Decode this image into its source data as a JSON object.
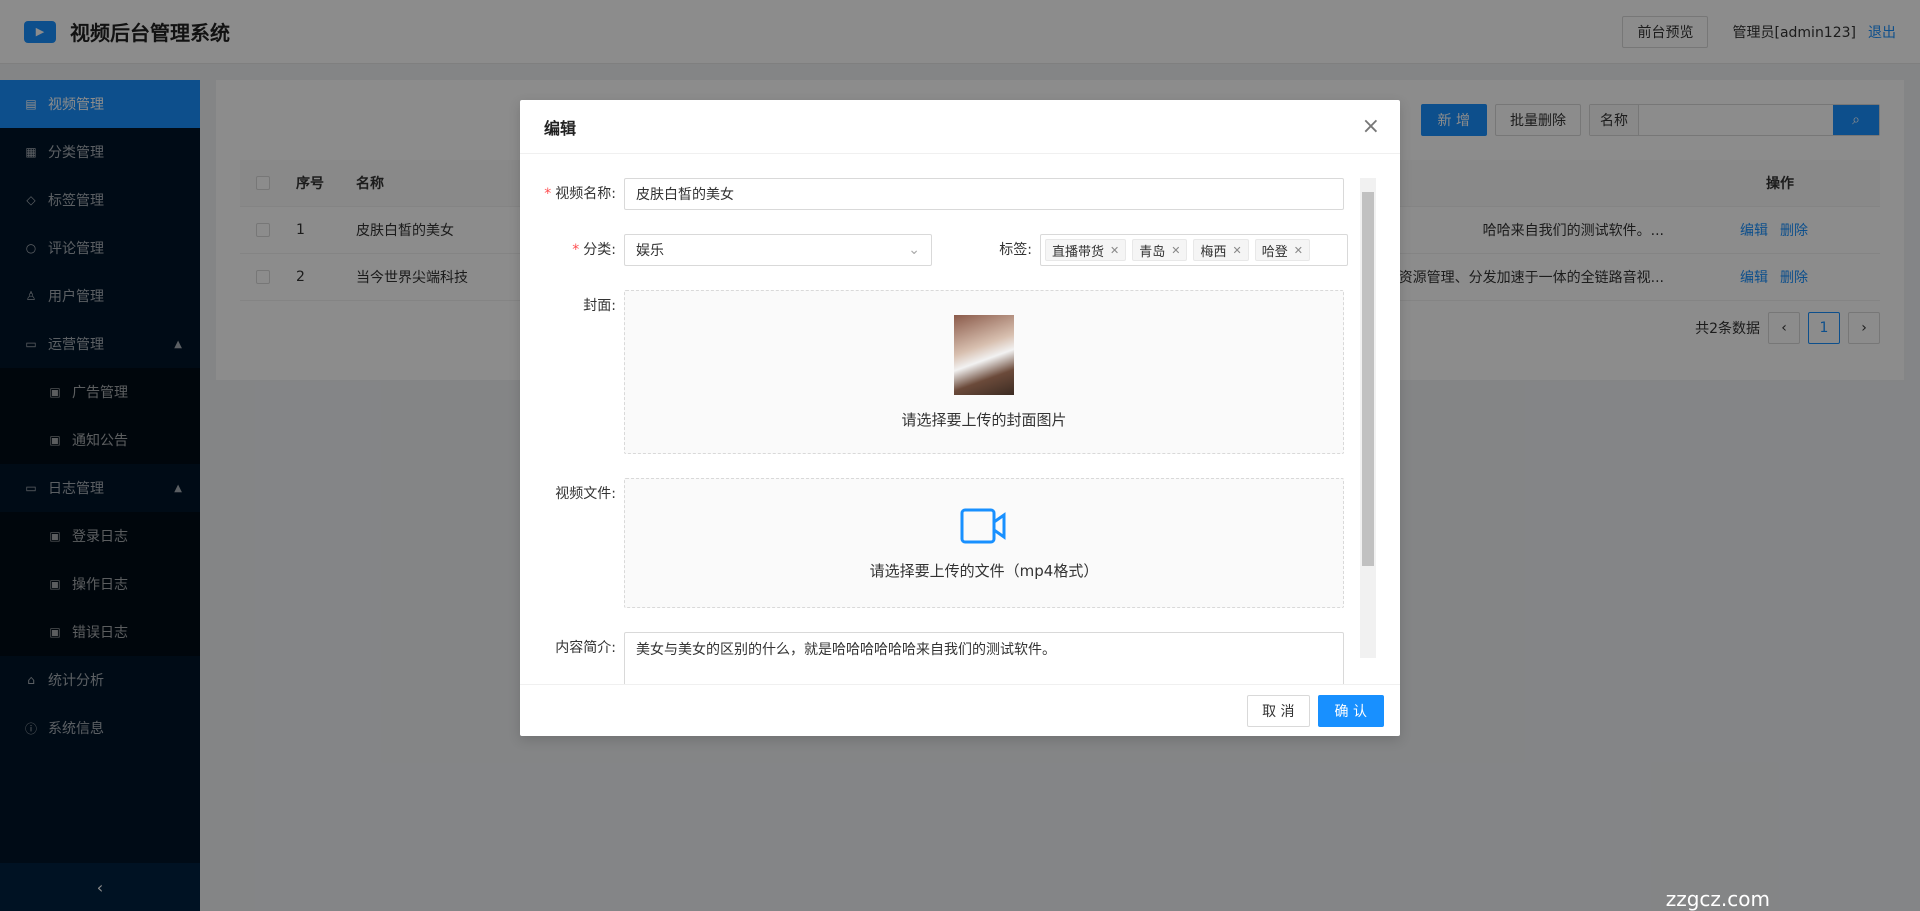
{
  "app": {
    "title": "视频后台管理系统"
  },
  "header": {
    "preview_label": "前台预览",
    "admin_label": "管理员[admin123]",
    "logout_label": "退出"
  },
  "sidebar": {
    "items": [
      {
        "label": "视频管理",
        "icon": "document-icon"
      },
      {
        "label": "分类管理",
        "icon": "table-icon"
      },
      {
        "label": "标签管理",
        "icon": "tag-icon"
      },
      {
        "label": "评论管理",
        "icon": "comment-icon"
      },
      {
        "label": "用户管理",
        "icon": "user-icon"
      },
      {
        "label": "运营管理",
        "icon": "folder-icon"
      },
      {
        "label": "广告管理",
        "icon": "grid-icon"
      },
      {
        "label": "通知公告",
        "icon": "grid-icon"
      },
      {
        "label": "日志管理",
        "icon": "folder-icon"
      },
      {
        "label": "登录日志",
        "icon": "grid-icon"
      },
      {
        "label": "操作日志",
        "icon": "grid-icon"
      },
      {
        "label": "错误日志",
        "icon": "grid-icon"
      },
      {
        "label": "统计分析",
        "icon": "home-icon"
      },
      {
        "label": "系统信息",
        "icon": "info-icon"
      }
    ]
  },
  "toolbar": {
    "add_label": "新 增",
    "batch_delete_label": "批量删除",
    "search_label": "名称",
    "search_placeholder": ""
  },
  "table": {
    "headers": [
      "序号",
      "名称",
      "操作"
    ],
    "rows": [
      {
        "index": "1",
        "name": "皮肤白皙的美女",
        "desc": "哈哈来自我们的测试软件。...",
        "edit": "编辑",
        "delete": "删除"
      },
      {
        "index": "2",
        "name": "当今世界尖端科技",
        "desc": "理、媒体资源管理、分发加速于一体的全链路音视...",
        "edit": "编辑",
        "delete": "删除"
      }
    ]
  },
  "pagination": {
    "total_label": "共2条数据",
    "current": "1"
  },
  "modal": {
    "title": "编辑",
    "name_label": "视频名称:",
    "name_value": "皮肤白皙的美女",
    "category_label": "分类:",
    "category_value": "娱乐",
    "tags_label": "标签:",
    "tags": [
      "直播带货",
      "青岛",
      "梅西",
      "哈登"
    ],
    "cover_label": "封面:",
    "cover_hint": "请选择要上传的封面图片",
    "video_label": "视频文件:",
    "video_hint": "请选择要上传的文件（mp4格式）",
    "intro_label": "内容简介:",
    "intro_value": "美女与美女的区别的什么，就是哈哈哈哈哈哈来自我们的测试软件。",
    "cancel_label": "取 消",
    "confirm_label": "确 认"
  },
  "watermark": "zzgcz.com"
}
